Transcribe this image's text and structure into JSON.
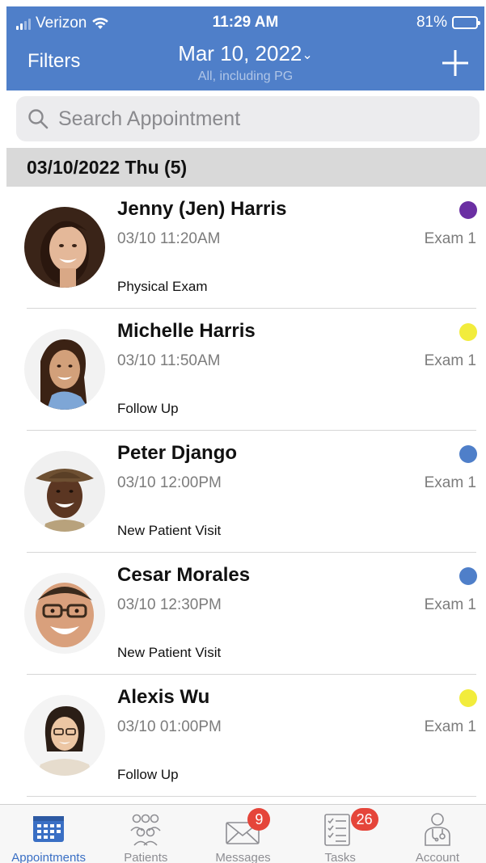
{
  "status_bar": {
    "carrier": "Verizon",
    "time": "11:29 AM",
    "battery": "81%",
    "battery_level": 0.81
  },
  "header": {
    "filters_label": "Filters",
    "date": "Mar 10, 2022",
    "chevron": "⌄",
    "subtitle": "All, including PG",
    "add_icon": "plus-icon"
  },
  "search": {
    "placeholder": "Search Appointment",
    "value": ""
  },
  "section": {
    "label": "03/10/2022 Thu (5)"
  },
  "appointments": [
    {
      "name": "Jenny (Jen) Harris",
      "time": "03/10 11:20AM",
      "room": "Exam 1",
      "type": "Physical Exam",
      "status_color": "#6b2fa3"
    },
    {
      "name": "Michelle Harris",
      "time": "03/10 11:50AM",
      "room": "Exam 1",
      "type": "Follow Up",
      "status_color": "#f2ec3c"
    },
    {
      "name": "Peter Django",
      "time": "03/10 12:00PM",
      "room": "Exam 1",
      "type": "New Patient Visit",
      "status_color": "#4f7fc9"
    },
    {
      "name": "Cesar Morales",
      "time": "03/10 12:30PM",
      "room": "Exam 1",
      "type": "New Patient Visit",
      "status_color": "#4f7fc9"
    },
    {
      "name": "Alexis Wu",
      "time": "03/10 01:00PM",
      "room": "Exam 1",
      "type": "Follow Up",
      "status_color": "#f2ec3c"
    }
  ],
  "tabs": [
    {
      "label": "Appointments",
      "icon": "calendar-icon",
      "active": true
    },
    {
      "label": "Patients",
      "icon": "patients-icon",
      "active": false
    },
    {
      "label": "Messages",
      "icon": "envelope-icon",
      "badge": "9"
    },
    {
      "label": "Tasks",
      "icon": "checklist-icon",
      "badge": "26"
    },
    {
      "label": "Account",
      "icon": "doctor-icon",
      "active": false
    }
  ],
  "colors": {
    "header_bg": "#4f7fc9",
    "active_tab": "#3a6fc4",
    "badge": "#e5453a"
  }
}
